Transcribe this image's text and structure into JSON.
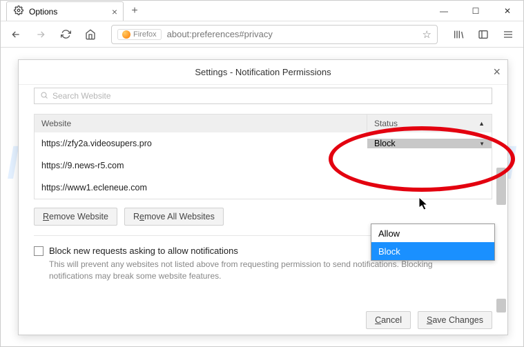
{
  "window": {
    "tab_title": "Options",
    "url_badge": "Firefox",
    "url": "about:preferences#privacy"
  },
  "dialog": {
    "title": "Settings - Notification Permissions",
    "search_placeholder": "Search Website",
    "columns": {
      "website": "Website",
      "status": "Status"
    },
    "rows": [
      {
        "site": "https://zfy2a.videosupers.pro",
        "status": "Block",
        "open": true
      },
      {
        "site": "https://9.news-r5.com",
        "status": ""
      },
      {
        "site": "https://www1.ecleneue.com",
        "status": ""
      }
    ],
    "dropdown": {
      "allow": "Allow",
      "block": "Block"
    },
    "buttons": {
      "remove_website": "Remove Website",
      "remove_all": "Remove All Websites",
      "cancel": "Cancel",
      "save": "Save Changes"
    },
    "block_new_label": "Block new requests asking to allow notifications",
    "block_new_help": "This will prevent any websites not listed above from requesting permission to send notifications. Blocking notifications may break some website features."
  },
  "watermark": "MYANTISPYWARE.COM"
}
